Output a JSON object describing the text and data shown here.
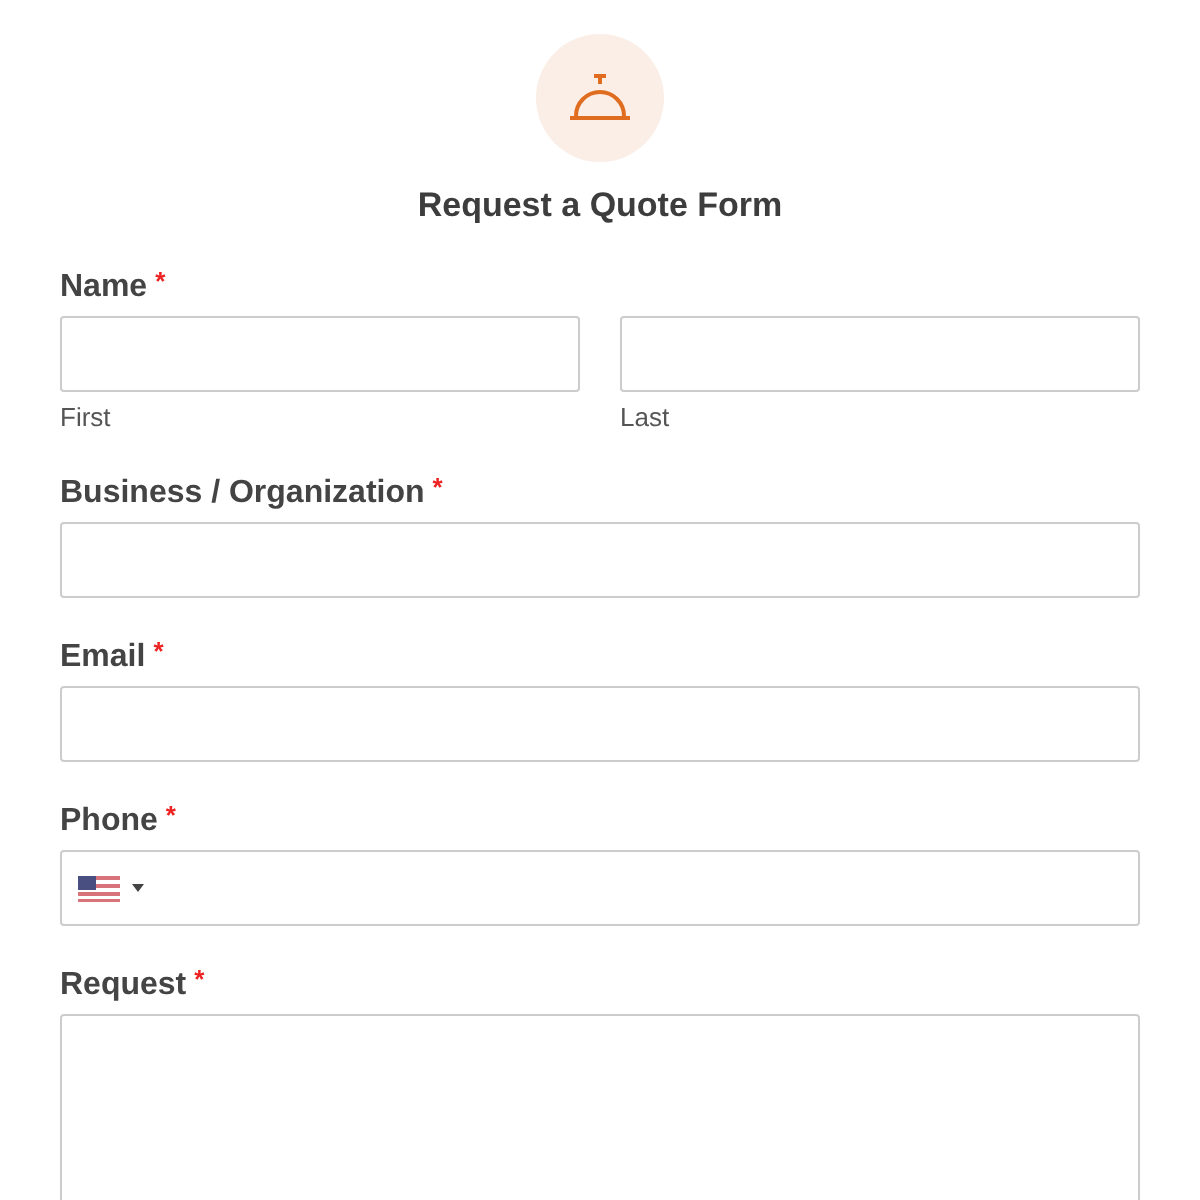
{
  "title": "Request a Quote Form",
  "fields": [
    {
      "kind": "name",
      "label": "Name",
      "required_mark": "*",
      "parts": [
        {
          "sublabel": "First"
        },
        {
          "sublabel": "Last"
        }
      ]
    },
    {
      "kind": "text",
      "label": "Business / Organization",
      "required_mark": "*"
    },
    {
      "kind": "text",
      "label": "Email",
      "required_mark": "*"
    },
    {
      "kind": "phone",
      "label": "Phone",
      "required_mark": "*"
    },
    {
      "kind": "textarea",
      "label": "Request",
      "required_mark": "*"
    }
  ]
}
